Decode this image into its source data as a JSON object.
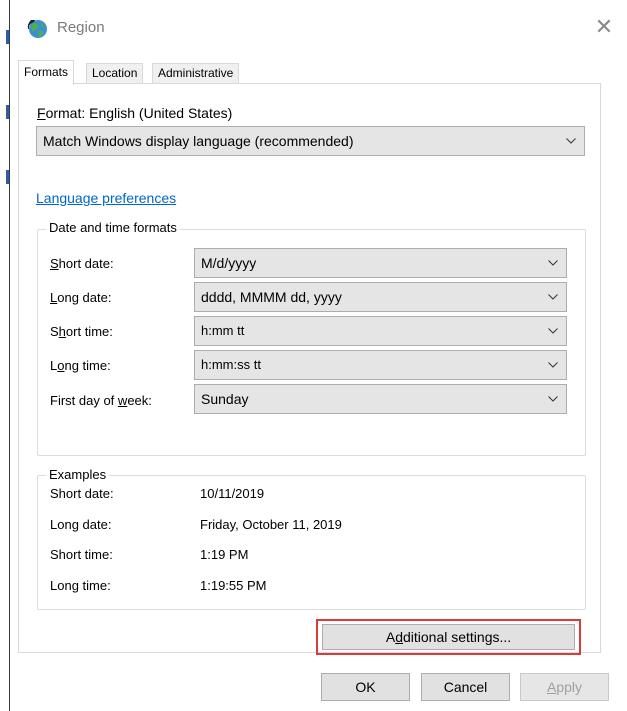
{
  "window": {
    "title": "Region",
    "close_glyph": "✕"
  },
  "tabs": [
    {
      "label": "Formats",
      "active": true
    },
    {
      "label": "Location",
      "active": false
    },
    {
      "label": "Administrative",
      "active": false
    }
  ],
  "format": {
    "label_prefix": "F",
    "label_rest": "ormat: English (United States)",
    "selected": "Match Windows display language (recommended)"
  },
  "language_preferences_link": "Language preferences",
  "date_time_formats": {
    "group_title": "Date and time formats",
    "rows": [
      {
        "label_pre": "",
        "label_key": "S",
        "label_post": "hort date:",
        "value": "M/d/yyyy"
      },
      {
        "label_pre": "",
        "label_key": "L",
        "label_post": "ong date:",
        "value": "dddd, MMMM dd, yyyy"
      },
      {
        "label_pre": "S",
        "label_key": "h",
        "label_post": "ort time:",
        "value": "h:mm tt"
      },
      {
        "label_pre": "L",
        "label_key": "o",
        "label_post": "ng time:",
        "value": "h:mm:ss tt"
      },
      {
        "label_pre": "First day of ",
        "label_key": "w",
        "label_post": "eek:",
        "value": "Sunday"
      }
    ]
  },
  "examples": {
    "group_title": "Examples",
    "rows": [
      {
        "label": "Short date:",
        "value": "10/11/2019"
      },
      {
        "label": "Long date:",
        "value": "Friday, October 11, 2019"
      },
      {
        "label": "Short time:",
        "value": "1:19 PM"
      },
      {
        "label": "Long time:",
        "value": "1:19:55 PM"
      }
    ]
  },
  "buttons": {
    "additional_pre": "A",
    "additional_key": "d",
    "additional_post": "ditional settings...",
    "ok": "OK",
    "cancel": "Cancel",
    "apply_key": "A",
    "apply_post": "pply"
  },
  "colors": {
    "highlight": "#d93a3a",
    "link": "#0066cc",
    "accent": "#2b5da8"
  }
}
